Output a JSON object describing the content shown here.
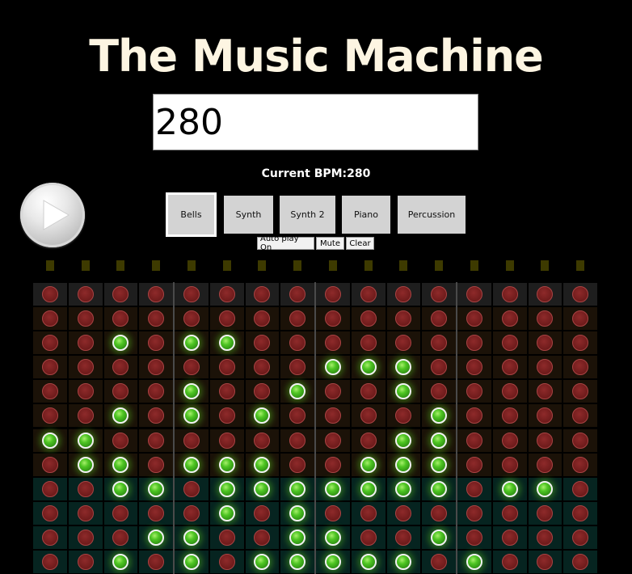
{
  "title": "The Music Machine",
  "bpm_input_value": "280",
  "bpm_label": "Current BPM:280",
  "instruments": [
    "Bells",
    "Synth",
    "Synth 2",
    "Piano",
    "Percussion"
  ],
  "selected_instrument": "Bells",
  "controls": {
    "autoplay": "Auto play On",
    "mute": "Mute",
    "clear": "Clear"
  },
  "colors": {
    "background": "#000000",
    "title": "#fdf5e2",
    "note_on": "#4ec523",
    "note_off": "#7a1f1f",
    "step_indicator": "#3d3a00"
  },
  "grid": {
    "rows": 12,
    "cols": 16,
    "active": [
      [],
      [],
      [
        2,
        4,
        5
      ],
      [
        8,
        9,
        10
      ],
      [
        4,
        7,
        10
      ],
      [
        2,
        4,
        6,
        11
      ],
      [
        0,
        1,
        10,
        11
      ],
      [
        1,
        2,
        4,
        5,
        6,
        9,
        10,
        11
      ],
      [
        2,
        3,
        5,
        6,
        7,
        8,
        9,
        10,
        11,
        13,
        14
      ],
      [
        5,
        7
      ],
      [
        3,
        4,
        7,
        8,
        11
      ],
      [
        2,
        4,
        6,
        7,
        8,
        9,
        10,
        12
      ]
    ]
  }
}
